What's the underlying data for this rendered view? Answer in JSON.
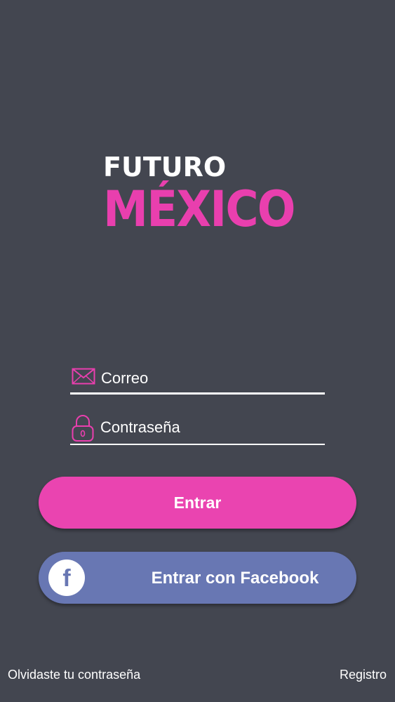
{
  "logo": {
    "line1": "FUTURO",
    "line2": "MÉXICO",
    "colors": {
      "line1": "#ffffff",
      "line2": "#e93fae"
    }
  },
  "form": {
    "email": {
      "placeholder": "Correo",
      "value": "",
      "icon": "envelope-icon"
    },
    "password": {
      "placeholder": "Contraseña",
      "value": "",
      "icon": "padlock-icon"
    }
  },
  "buttons": {
    "login_label": "Entrar",
    "facebook_label": "Entrar con Facebook",
    "facebook_icon": "facebook-icon",
    "facebook_glyph": "f"
  },
  "links": {
    "forgot_password": "Olvidaste tu contraseña",
    "register": "Registro"
  },
  "colors": {
    "background": "#434650",
    "accent": "#ea44b0",
    "facebook": "#6877b3"
  }
}
